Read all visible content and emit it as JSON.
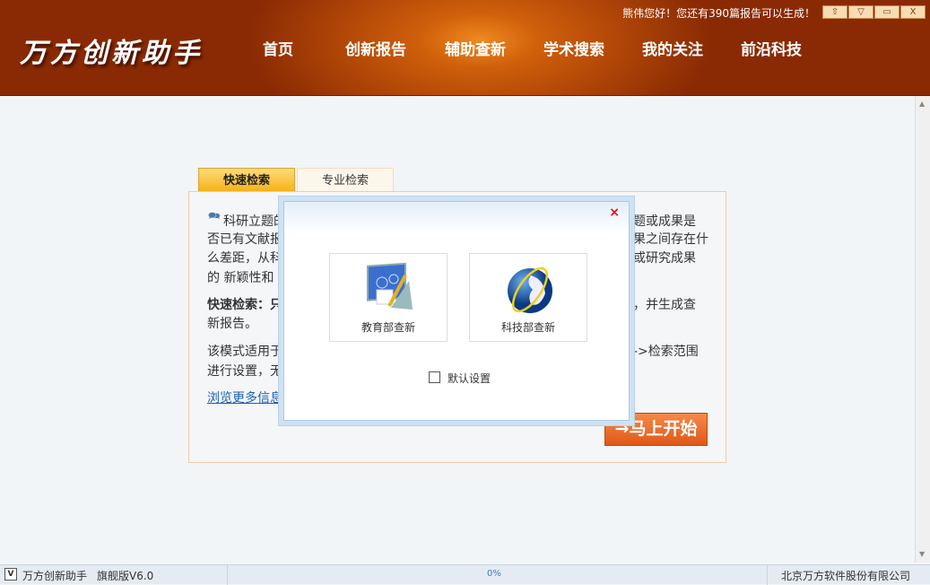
{
  "header": {
    "logo": "万方创新助手",
    "greeting": "熊伟您好！您还有390篇报告可以生成！",
    "nav": [
      "首页",
      "创新报告",
      "辅助查新",
      "学术搜索",
      "我的关注",
      "前沿科技"
    ],
    "window_buttons": [
      "skin",
      "menu",
      "minimize",
      "close"
    ]
  },
  "tabs": [
    "快速检索",
    "专业检索"
  ],
  "panel": {
    "left": [
      "科研立题的",
      "否已有文献报",
      "么差距，从科",
      "的 新颖性和",
      "快速检索：只",
      "新报告。",
      "该模式适用于",
      "进行设置，无"
    ],
    "right": [
      "题或成果是",
      "果之间存在什",
      "或研究成果",
      "，并生成查",
      "->检索范围"
    ],
    "more_link": "浏览更多信息",
    "start_button": "→马上开始"
  },
  "modal": {
    "close": "×",
    "options": [
      "教育部查新",
      "科技部查新"
    ],
    "checkbox_label": "默认设置",
    "checkbox_checked": false
  },
  "status": {
    "app": "万方创新助手",
    "edition": "旗舰版V6.0",
    "progress": "0%",
    "company": "北京万方软件股份有限公司"
  }
}
